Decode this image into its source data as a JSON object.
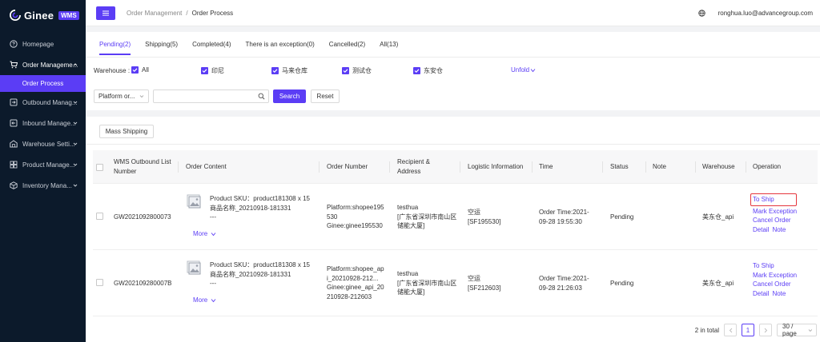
{
  "sidebar": {
    "logo_text": "Ginee",
    "logo_badge": "WMS",
    "items": [
      {
        "label": "Homepage",
        "icon": "question-circle-icon"
      },
      {
        "label": "Order Manageme...",
        "icon": "cart-icon"
      },
      {
        "label": "Outbound Manag...",
        "icon": "outbound-icon"
      },
      {
        "label": "Inbound Manage...",
        "icon": "inbound-icon"
      },
      {
        "label": "Warehouse Setti...",
        "icon": "warehouse-icon"
      },
      {
        "label": "Product Manage...",
        "icon": "product-icon"
      },
      {
        "label": "Inventory Mana...",
        "icon": "inventory-icon"
      }
    ],
    "sub_item_active": "Order Process",
    "accent": "#5b3df5",
    "bg": "#0c1a2b"
  },
  "topbar": {
    "breadcrumb": [
      "Order Management",
      "/",
      "Order Process"
    ],
    "user_email": "ronghua.luo@advancegroup.com",
    "icons": [
      "menu-icon",
      "globe-icon"
    ]
  },
  "tabs": [
    {
      "label": "Pending(2)",
      "active": true
    },
    {
      "label": "Shipping(5)",
      "active": false
    },
    {
      "label": "Completed(4)",
      "active": false
    },
    {
      "label": "There is an exception(0)",
      "active": false
    },
    {
      "label": "Cancelled(2)",
      "active": false
    },
    {
      "label": "All(13)",
      "active": false
    }
  ],
  "warehouse_filter": {
    "label": "Warehouse :",
    "options": [
      {
        "label": "All",
        "checked": true
      },
      {
        "label": "印尼",
        "checked": true
      },
      {
        "label": "马来仓库",
        "checked": true
      },
      {
        "label": "测试仓",
        "checked": true
      },
      {
        "label": "东安仓",
        "checked": true
      }
    ],
    "unfold_label": "Unfold"
  },
  "filters": {
    "select_value": "Platform or...",
    "search_value": "",
    "search_label": "Search",
    "reset_label": "Reset"
  },
  "mass_shipping_label": "Mass Shipping",
  "table": {
    "headers": {
      "outbound": [
        "WMS Outbound List",
        "Number"
      ],
      "content": "Order Content",
      "order_number": "Order Number",
      "recipient": [
        "Recipient &",
        "Address"
      ],
      "logistic": "Logistic Information",
      "time": "Time",
      "status": "Status",
      "note": "Note",
      "warehouse": "Warehouse",
      "operation": "Operation"
    },
    "rows": [
      {
        "outbound": "GW2021092800073",
        "content": [
          "Product SKU：product181308 x 15",
          "商品名称_20210918-181331",
          "---"
        ],
        "more": "More",
        "order_number": [
          "Platform:shopee195",
          "530",
          "Ginee:ginee195530"
        ],
        "recipient": [
          "testhua",
          "[广东省深圳市南山区",
          "储能大厦]"
        ],
        "logistic": [
          "空运",
          "[SF195530]"
        ],
        "time": [
          "Order Time:2021-",
          "09-28 19:55:30"
        ],
        "status": "Pending",
        "warehouse": "美东仓_api",
        "ops": {
          "ship": "To Ship",
          "exception": "Mark Exception",
          "cancel": "Cancel Order",
          "detail": "Detail",
          "note": "Note"
        },
        "highlight_ship": true
      },
      {
        "outbound": "GW202109280007B",
        "content": [
          "Product SKU：product181308 x 15",
          "商品名称_20210928-181331",
          "---"
        ],
        "more": "More",
        "order_number": [
          "Platform:shopee_ap",
          "i_20210928-212...",
          "Ginee:ginee_api_20",
          "210928-212603"
        ],
        "recipient": [
          "testhua",
          "[广东省深圳市南山区",
          "储能大厦]"
        ],
        "logistic": [
          "空运",
          "[SF212603]"
        ],
        "time": [
          "Order Time:2021-",
          "09-28 21:26:03"
        ],
        "status": "Pending",
        "warehouse": "美东仓_api",
        "ops": {
          "ship": "To Ship",
          "exception": "Mark Exception",
          "cancel": "Cancel Order",
          "detail": "Detail",
          "note": "Note"
        },
        "highlight_ship": false
      }
    ]
  },
  "pagination": {
    "total": "2 in total",
    "current": "1",
    "page_size": "30 / page"
  }
}
